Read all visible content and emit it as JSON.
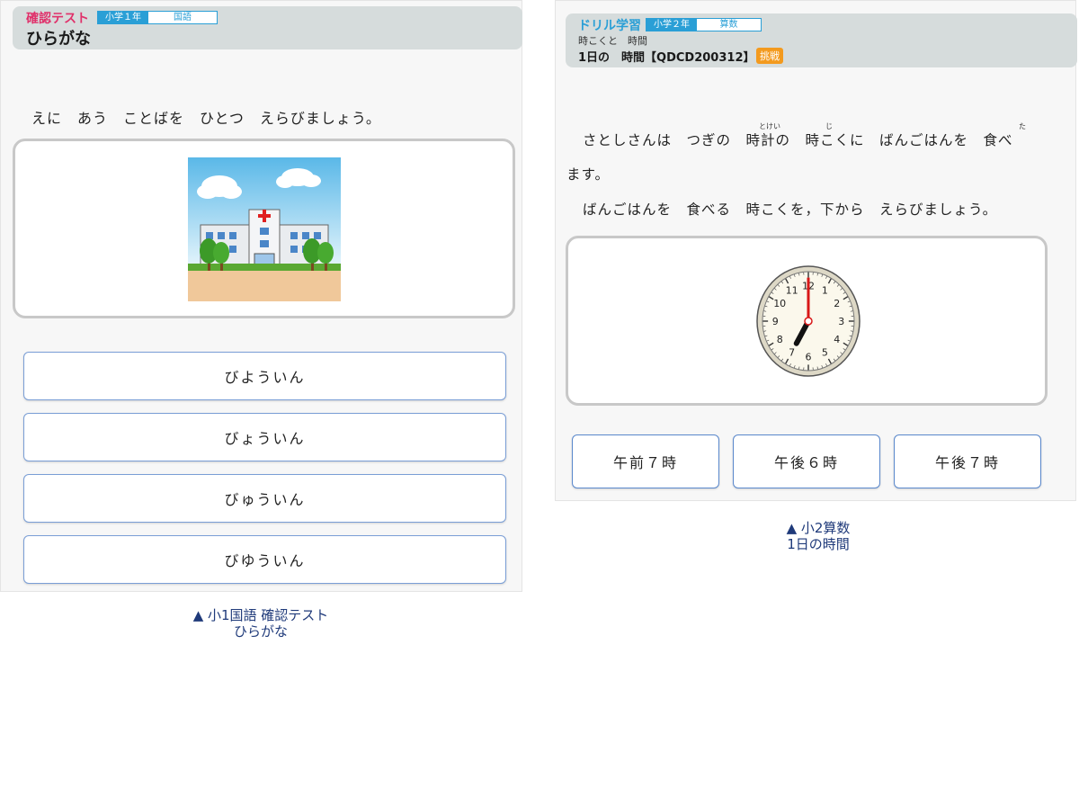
{
  "left_panel": {
    "brand": "確認テスト",
    "grade_tag": "小学１年",
    "subject_tag": "国語",
    "title": "ひらがな",
    "question": "えに　あう　ことばを　ひとつ　えらびましょう。",
    "answers": [
      "びよういん",
      "びょういん",
      "びゅういん",
      "びゆういん"
    ],
    "colors": {
      "brand": "#e0306a",
      "tag": "#2a9fd6"
    },
    "image": "hospital-illustration"
  },
  "right_panel": {
    "brand": "ドリル学習",
    "grade_tag": "小学２年",
    "subject_tag": "算数",
    "unit": "時こくと　時間",
    "title": "1日の　時間【QDCD200312】",
    "badge": "挑戦",
    "question_line1": "さとしさんは　つぎの　時計の　時こくに　ばんごはんを　食べ",
    "ruby_tokei": "とけい",
    "ruby_ji": "じ",
    "ruby_ta": "た",
    "question_line2": "ます。",
    "question_line3": "ばんごはんを　食べる　時こくを，下から　えらびましょう。",
    "answers": [
      "午前７時",
      "午後６時",
      "午後７時"
    ],
    "clock": {
      "hour": 7,
      "minute": 0,
      "numerals": [
        "12",
        "1",
        "2",
        "3",
        "4",
        "5",
        "6",
        "7",
        "8",
        "9",
        "10",
        "11"
      ]
    },
    "colors": {
      "brand": "#2a9fd6",
      "badge": "#f39a1e"
    }
  },
  "captions": {
    "left": [
      "▲ 小1国語 確認テスト",
      "ひらがな"
    ],
    "right": [
      "▲ 小2算数",
      "1日の時間"
    ]
  }
}
